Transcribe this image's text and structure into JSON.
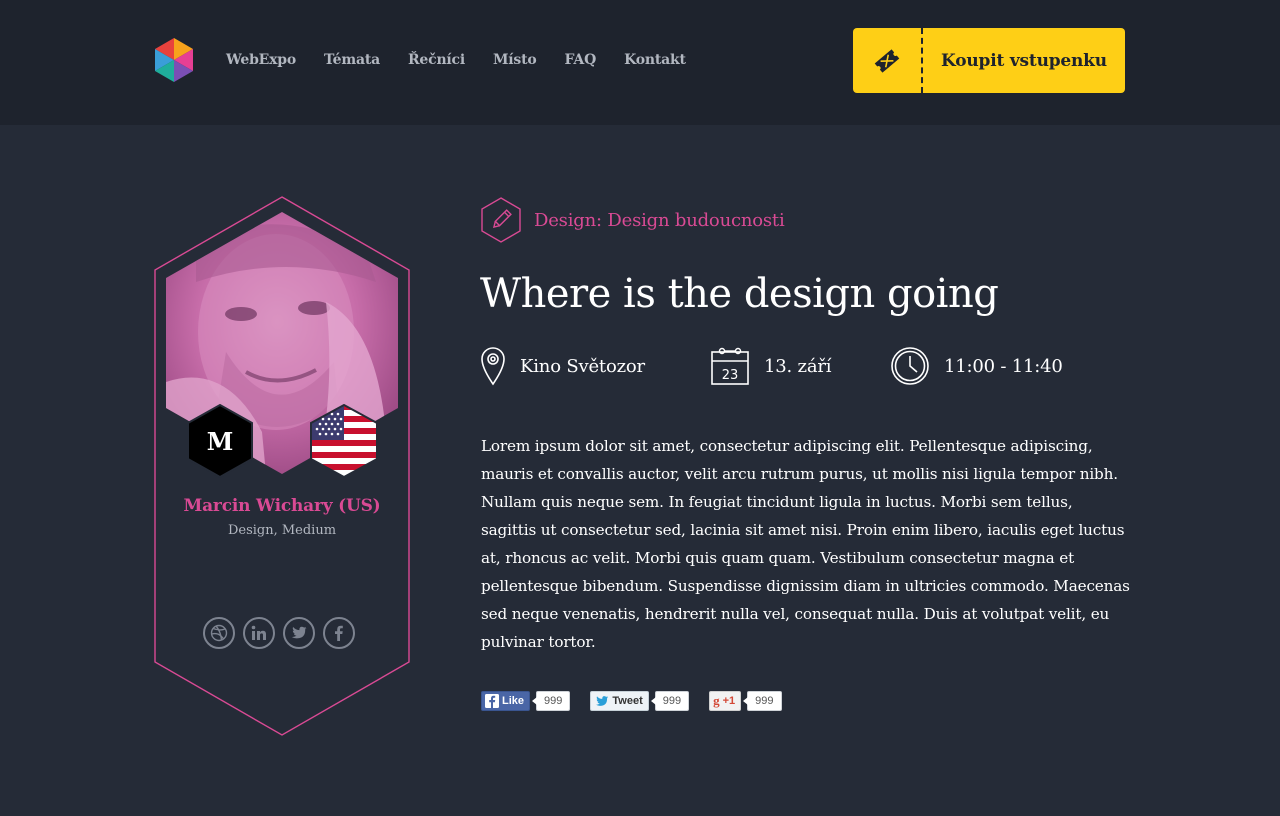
{
  "colors": {
    "accent": "#d94a94",
    "cta": "#fecf16",
    "background": "#252b37",
    "header": "#1e232d"
  },
  "nav": {
    "items": [
      "WebExpo",
      "Témata",
      "Řečníci",
      "Místo",
      "FAQ",
      "Kontakt"
    ],
    "cta_label": "Koupit vstupenku"
  },
  "speaker": {
    "name": "Marcin Wichary (US)",
    "tags": "Design, Medium",
    "company_badge": "M",
    "country_flag": "us-flag-icon",
    "socials": [
      "dribbble-icon",
      "linkedin-icon",
      "twitter-icon",
      "facebook-icon"
    ]
  },
  "talk": {
    "category": "Design: Design budoucnosti",
    "title": "Where is the design going",
    "venue": "Kino Světozor",
    "calendar_day": "23",
    "date": "13. září",
    "time": "11:00 - 11:40",
    "description": "Lorem ipsum dolor sit amet, consectetur adipiscing elit. Pellentesque adipiscing, mauris et convallis auctor, velit arcu rutrum purus, ut mollis nisi ligula tempor nibh. Nullam quis neque sem. In feugiat tincidunt ligula in luctus. Morbi sem tellus, sagittis ut consectetur sed, lacinia sit amet nisi. Proin enim libero, iaculis eget luctus at, rhoncus ac velit. Morbi quis quam quam. Vestibulum consectetur magna et pellentesque bibendum. Suspendisse dignissim diam in ultricies commodo. Maecenas sed neque venenatis, hendrerit nulla vel, consequat nulla. Duis at volutpat velit, eu pulvinar tortor."
  },
  "share": {
    "facebook": {
      "label": "Like",
      "count": "999"
    },
    "twitter": {
      "label": "Tweet",
      "count": "999"
    },
    "google": {
      "label": "+1",
      "count": "999"
    }
  }
}
